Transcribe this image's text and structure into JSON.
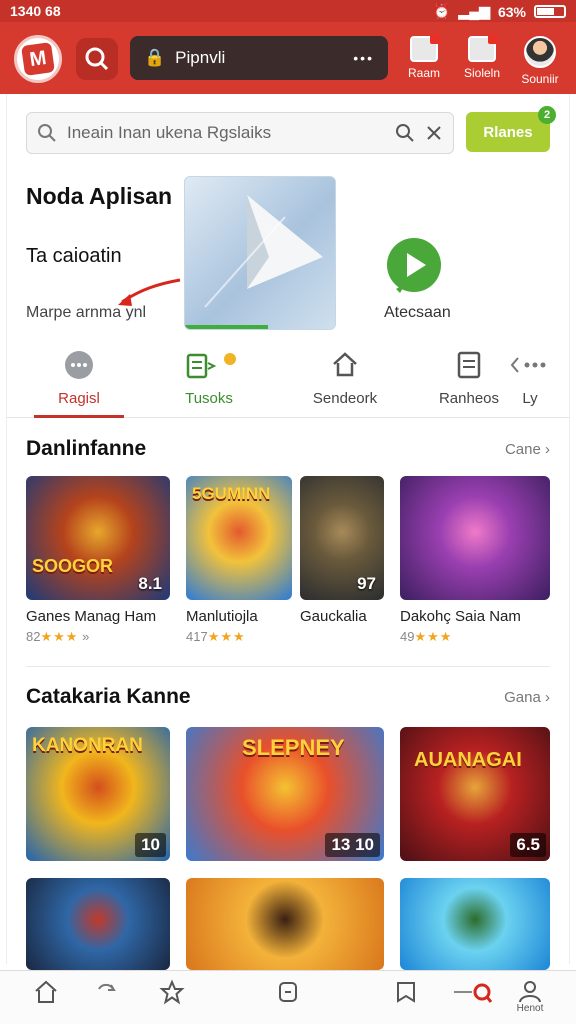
{
  "status": {
    "time": "1340 68",
    "battery": "63%"
  },
  "header": {
    "search_box": "Pipnvli",
    "actions": [
      {
        "label": "Raam"
      },
      {
        "label": "Sioleln"
      },
      {
        "label": "Souniir"
      }
    ]
  },
  "search": {
    "placeholder": "Ineain Inan ukena Rgslaiks",
    "button": "Rlanes",
    "badge": "2"
  },
  "promo": {
    "title": "Noda Aplisan",
    "subtitle": "Ta caioatin",
    "note": "Marpe arnma ynl",
    "action_label": "Atecsaan"
  },
  "tabs": [
    {
      "label": "Ragisl",
      "icon": "chat-icon"
    },
    {
      "label": "Tusoks",
      "icon": "tasks-icon"
    },
    {
      "label": "Sendeork",
      "icon": "home-icon"
    },
    {
      "label": "Ranheos",
      "icon": "list-icon"
    },
    {
      "label": "Ly",
      "icon": "more-icon"
    }
  ],
  "section1": {
    "title": "Danlinfanne",
    "more": "Cane",
    "games": [
      {
        "name": "Ganes Manag Ham",
        "rating": "82",
        "extra": "»",
        "stars": 3,
        "overlay": "SOOGOR",
        "badge": "8.1",
        "colors": [
          "#1d3a78",
          "#b5431c",
          "#e7a72c"
        ]
      },
      {
        "name": "Manlutiojla",
        "rating": "417",
        "extra": "",
        "stars": 3,
        "overlay": "5GUMINN",
        "badge": "",
        "colors": [
          "#2c7ad6",
          "#f2c23b",
          "#e35a2e"
        ]
      },
      {
        "name": "Gauckalia",
        "rating": "",
        "extra": "",
        "stars": 0,
        "overlay": "",
        "badge": "97",
        "colors": [
          "#2b2d2f",
          "#6a5a3c",
          "#a88a5a"
        ]
      },
      {
        "name": "Dakohç Saia Nam",
        "rating": "49",
        "extra": "",
        "stars": 3,
        "overlay": "",
        "badge": "",
        "colors": [
          "#3b1f5e",
          "#9a3fb1",
          "#f07ac8"
        ]
      }
    ]
  },
  "section2": {
    "title": "Catakaria Kanne",
    "more": "Gana",
    "games": [
      {
        "overlay": "KANONRAN",
        "badge": "10",
        "colors": [
          "#2063b0",
          "#f1b61d",
          "#d44f1c"
        ]
      },
      {
        "overlay": "SLEPNEY",
        "badge": "13 10",
        "colors": [
          "#3a7ad0",
          "#e9502b",
          "#f4c231"
        ]
      },
      {
        "overlay": "AUANAGAI",
        "badge": "6.5",
        "colors": [
          "#4a1015",
          "#b82121",
          "#e6a53a"
        ]
      }
    ],
    "more_games": [
      {
        "colors": [
          "#1a2740",
          "#2f67a6",
          "#c1392b"
        ]
      },
      {
        "colors": [
          "#d9761c",
          "#f3b23a",
          "#3a2012"
        ]
      },
      {
        "colors": [
          "#1d86d6",
          "#6bd2f0",
          "#2d6d2b"
        ]
      }
    ]
  },
  "bottom_nav": [
    {
      "label": "",
      "icon": "home-icon"
    },
    {
      "label": "",
      "icon": "refresh-icon"
    },
    {
      "label": "",
      "icon": "star-icon"
    },
    {
      "label": "",
      "icon": "square-icon"
    },
    {
      "label": "",
      "icon": "bookmark-icon"
    },
    {
      "label": "",
      "icon": "toggle-icon"
    },
    {
      "label": "Henot",
      "icon": "profile-icon"
    }
  ]
}
